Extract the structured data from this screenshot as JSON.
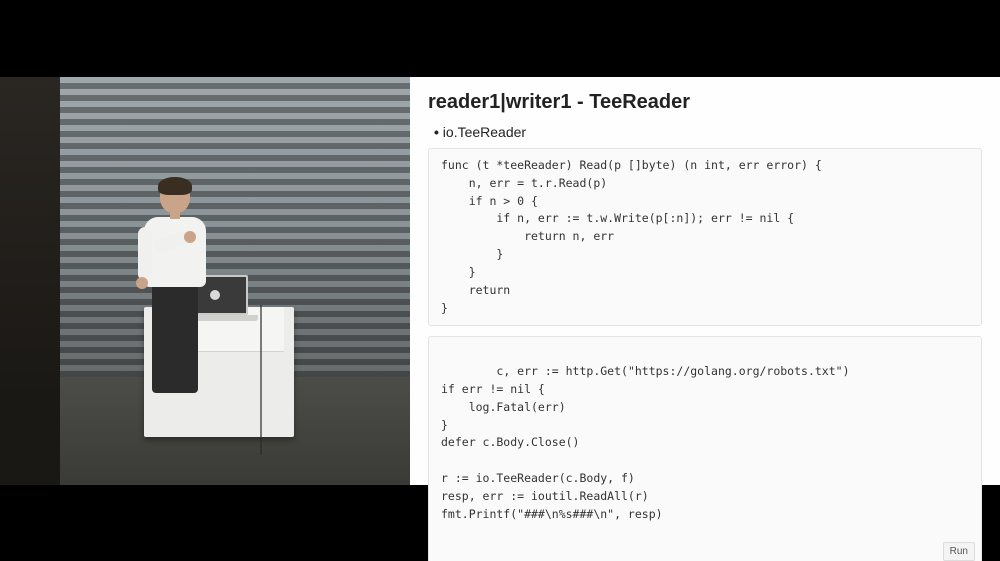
{
  "slide": {
    "title": "reader1|writer1 - TeeReader",
    "bullet": "io.TeeReader",
    "code1": "func (t *teeReader) Read(p []byte) (n int, err error) {\n    n, err = t.r.Read(p)\n    if n > 0 {\n        if n, err := t.w.Write(p[:n]); err != nil {\n            return n, err\n        }\n    }\n    return\n}",
    "code2": "c, err := http.Get(\"https://golang.org/robots.txt\")\nif err != nil {\n    log.Fatal(err)\n}\ndefer c.Body.Close()\n\nr := io.TeeReader(c.Body, f)\nresp, err := ioutil.ReadAll(r)\nfmt.Printf(\"###\\n%s###\\n\", resp)",
    "run_label": "Run"
  }
}
